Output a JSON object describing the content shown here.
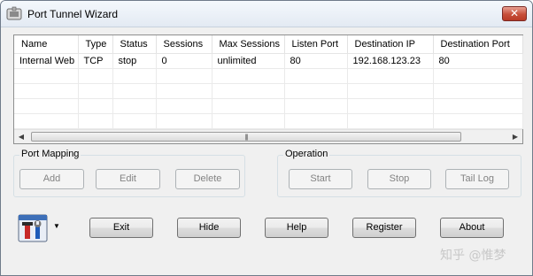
{
  "window": {
    "title": "Port Tunnel Wizard",
    "close_glyph": "✕"
  },
  "table": {
    "columns": [
      "Name",
      "Type",
      "Status",
      "Sessions",
      "Max Sessions",
      "Listen Port",
      "Destination IP",
      "Destination Port"
    ],
    "rows": [
      [
        "Internal Web",
        "TCP",
        "stop",
        "0",
        "unlimited",
        "80",
        "192.168.123.23",
        "80"
      ]
    ]
  },
  "scrollbar": {
    "left_arrow": "◀",
    "right_arrow": "▶",
    "grip": "|||"
  },
  "port_mapping": {
    "label": "Port Mapping",
    "add": "Add",
    "edit": "Edit",
    "delete": "Delete"
  },
  "operation": {
    "label": "Operation",
    "start": "Start",
    "stop": "Stop",
    "tail_log": "Tail Log"
  },
  "footer": {
    "exit": "Exit",
    "hide": "Hide",
    "help": "Help",
    "register": "Register",
    "about": "About",
    "menu_arrow": "▼"
  },
  "watermark": "知乎 @惟梦",
  "icons": {
    "app": "tunnel-app-icon",
    "tools": "tools-icon"
  },
  "colors": {
    "close_button": "#c74f3a",
    "window_bg": "#f0f0f0",
    "disabled_text": "#838383"
  }
}
